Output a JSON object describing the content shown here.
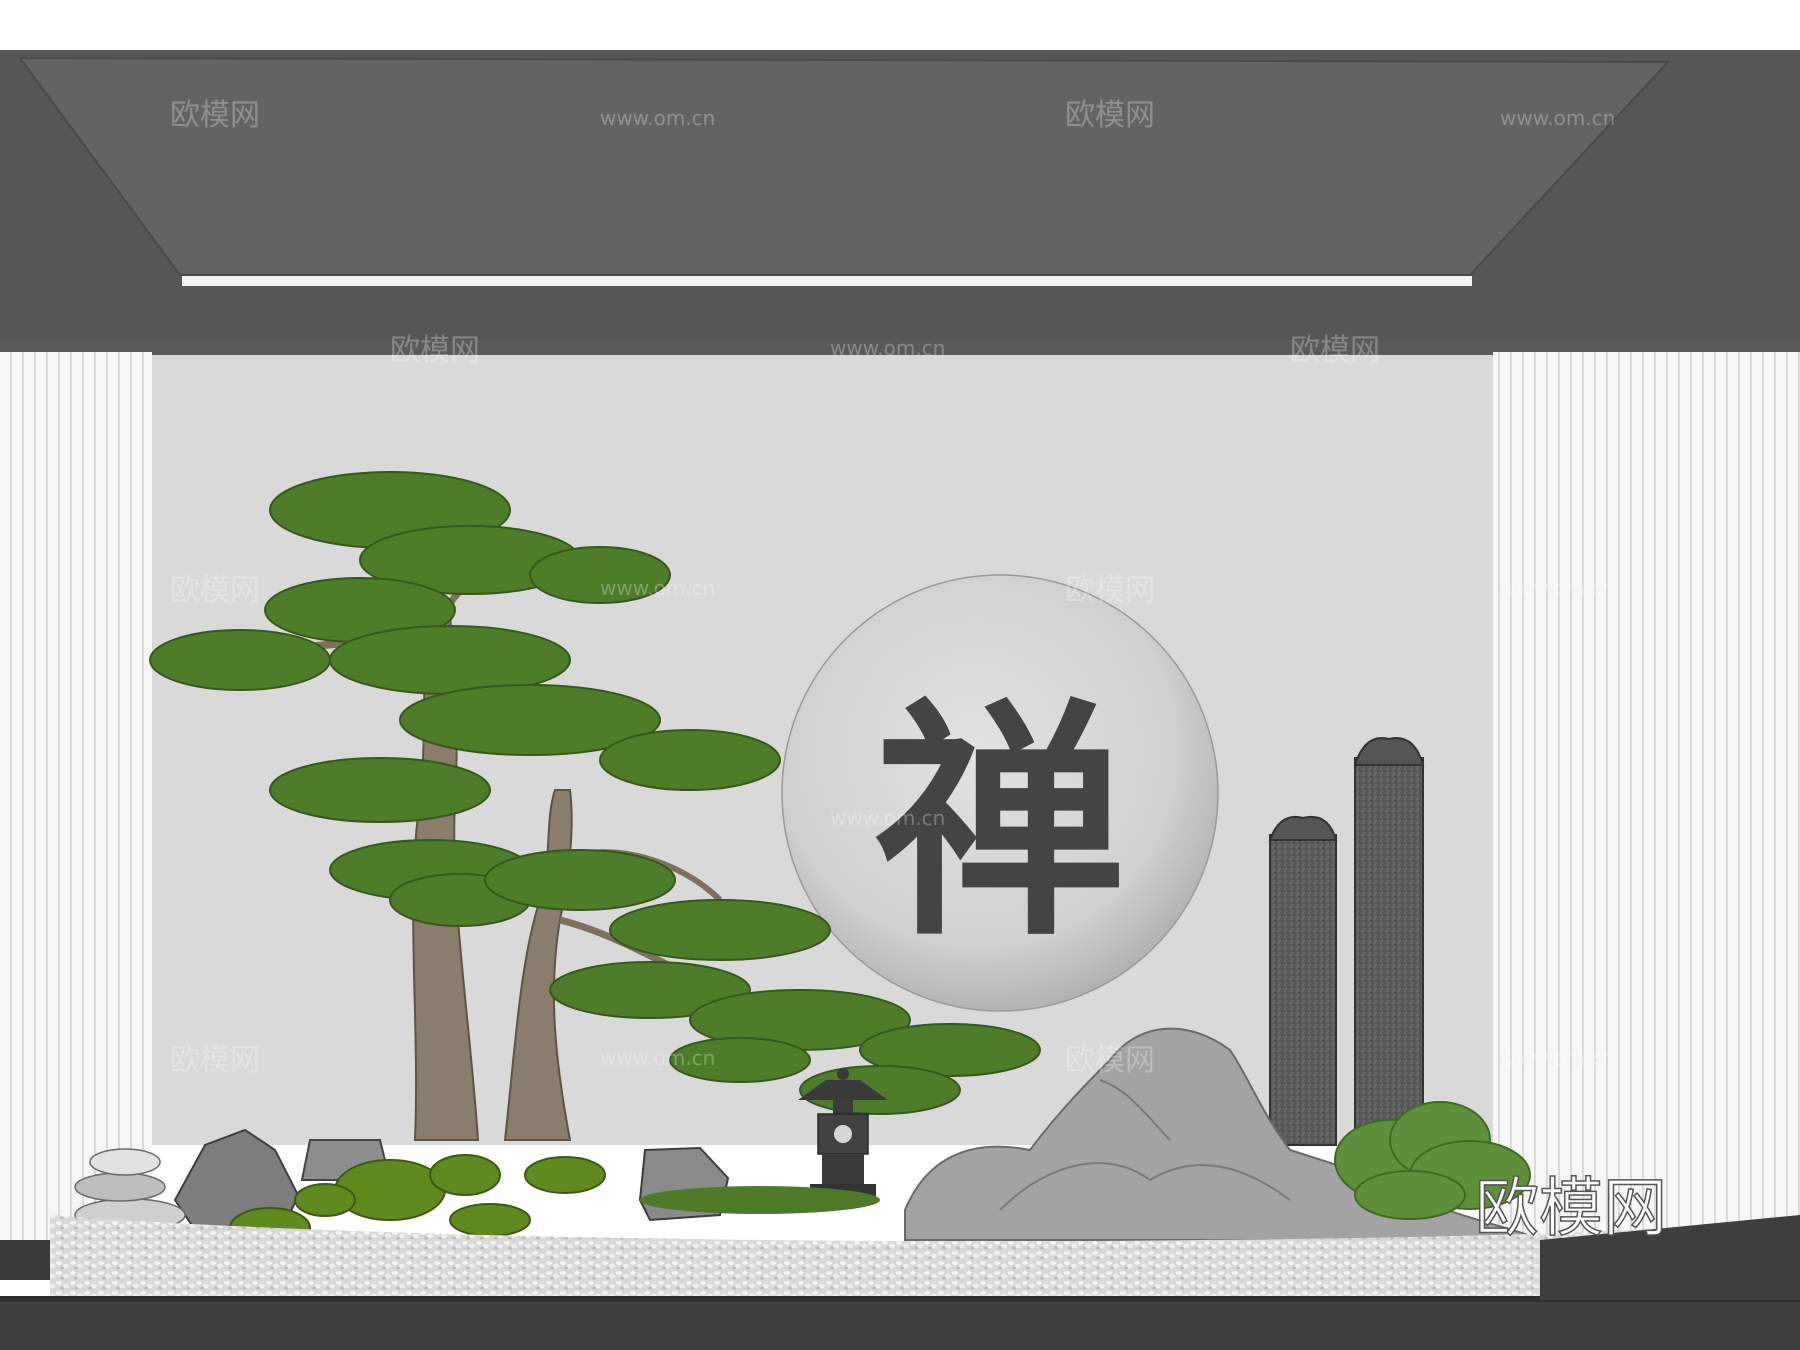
{
  "scene": {
    "calligraphy": "禅",
    "watermark_cn": "欧模网",
    "watermark_url": "www.om.cn",
    "brand_mark": "欧模网"
  },
  "colors": {
    "ceiling": "#5b5b5b",
    "ceiling_inner": "#636363",
    "light_strip": "#f4f4f4",
    "wall": "#d9d9d9",
    "slats": "#f5f5f5",
    "moon": "#d2d2d2",
    "pine_green": "#4e7d2a",
    "pine_dark": "#3a6420",
    "trunk": "#8a7d6c",
    "stone_pillar": "#5c5c5c",
    "rock": "#9a9a9a",
    "moss": "#5f8a1e",
    "gravel": "#e6e6e6",
    "planter": "#3e3e3e",
    "calligraphy_ink": "#444444"
  }
}
